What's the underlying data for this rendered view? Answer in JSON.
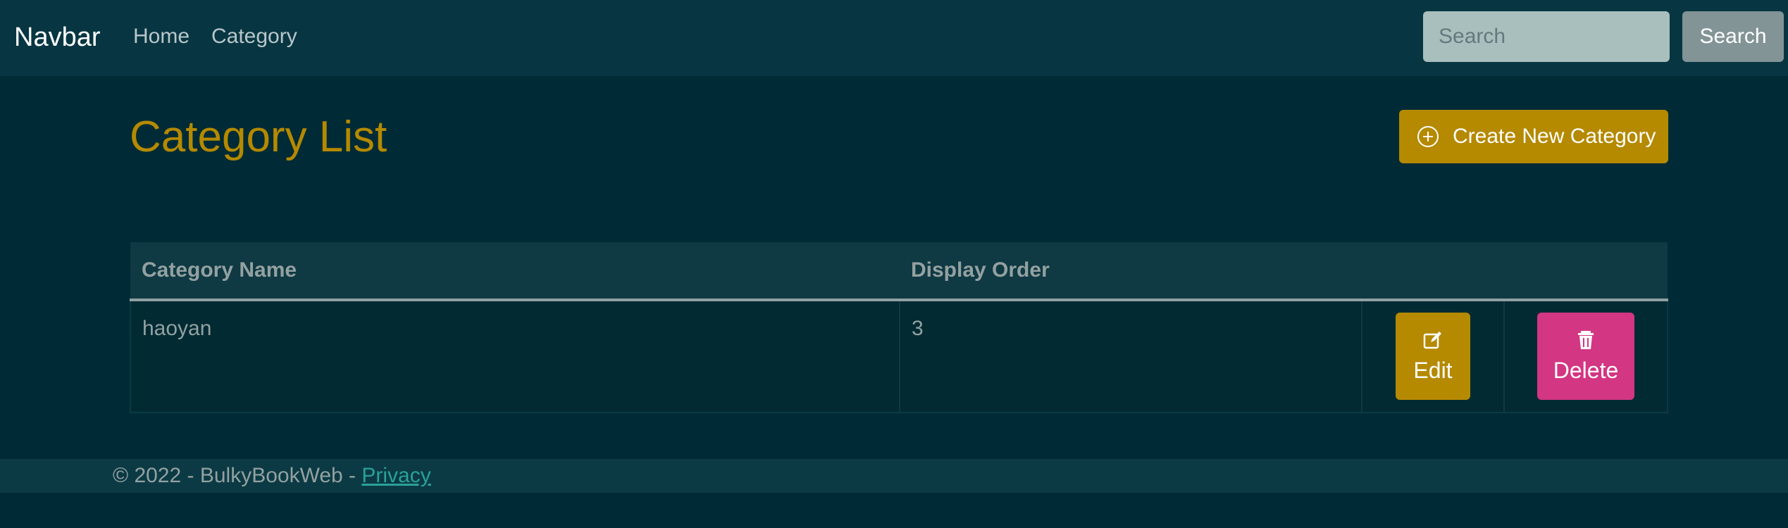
{
  "navbar": {
    "brand": "Navbar",
    "links": [
      {
        "label": "Home"
      },
      {
        "label": "Category"
      }
    ],
    "search": {
      "placeholder": "Search",
      "button_label": "Search"
    }
  },
  "page": {
    "title": "Category List",
    "create_button_label": "Create New Category",
    "create_icon": "plus-circle-icon"
  },
  "table": {
    "columns": [
      "Category Name",
      "Display Order"
    ],
    "rows": [
      {
        "name": "haoyan",
        "display_order": "3",
        "edit_label": "Edit",
        "delete_label": "Delete"
      }
    ]
  },
  "footer": {
    "text": "© 2022 - BulkyBookWeb - ",
    "link_label": "Privacy"
  },
  "colors": {
    "background": "#002b36",
    "navbar": "#073642",
    "accent": "#b58900",
    "danger": "#d33682",
    "link": "#2aa198"
  }
}
